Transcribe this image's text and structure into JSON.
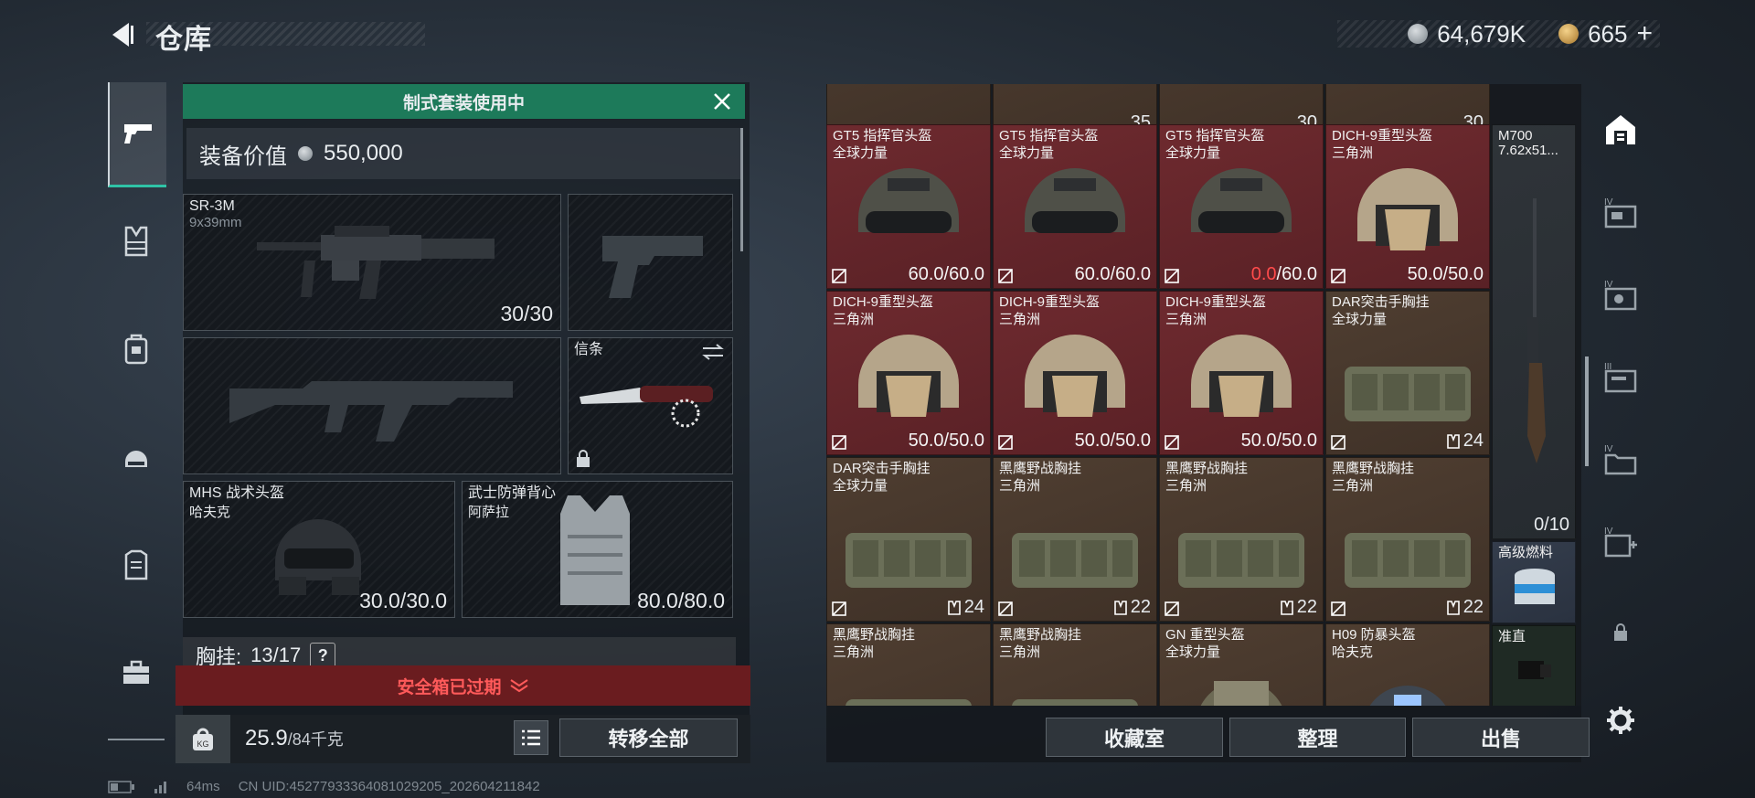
{
  "header": {
    "title": "仓库",
    "currency1": "64,679K",
    "currency2": "665",
    "currency2_suffix": "+"
  },
  "equipment": {
    "banner": "制式套装使用中",
    "value_label": "装备价值",
    "value": "550,000",
    "primary": {
      "name": "SR-3M",
      "ammo": "9x39mm",
      "count": "30/30"
    },
    "knife": {
      "name": "信条"
    },
    "helmet": {
      "name": "MHS 战术头盔",
      "origin": "哈夫克",
      "durability": "30.0/30.0"
    },
    "armor": {
      "name": "武士防弹背心",
      "origin": "阿萨拉",
      "durability": "80.0/80.0"
    },
    "chest_label": "胸挂:",
    "chest_value": "13/17",
    "help": "?",
    "safe_box": "安全箱已过期",
    "weight": "25.9",
    "weight_max": "/84千克",
    "transfer_all": "转移全部"
  },
  "warehouse": {
    "top_counts": [
      "35",
      "30",
      "30"
    ],
    "rows": [
      [
        {
          "name": "GT5 指挥官头盔",
          "sub": "全球力量",
          "val_a": "60.0",
          "val_b": "/60.0",
          "bg": "red",
          "icon": "helmet-gt5"
        },
        {
          "name": "GT5 指挥官头盔",
          "sub": "全球力量",
          "val_a": "60.0",
          "val_b": "/60.0",
          "bg": "red",
          "icon": "helmet-gt5"
        },
        {
          "name": "GT5 指挥官头盔",
          "sub": "全球力量",
          "val_a": "0.0",
          "val_b": "/60.0",
          "bg": "red",
          "icon": "helmet-gt5",
          "val_a_red": true
        },
        {
          "name": "DICH-9重型头盔",
          "sub": "三角洲",
          "val_a": "50.0",
          "val_b": "/50.0",
          "bg": "red",
          "icon": "helmet-dich"
        }
      ],
      [
        {
          "name": "DICH-9重型头盔",
          "sub": "三角洲",
          "val_a": "50.0",
          "val_b": "/50.0",
          "bg": "red",
          "icon": "helmet-dich"
        },
        {
          "name": "DICH-9重型头盔",
          "sub": "三角洲",
          "val_a": "50.0",
          "val_b": "/50.0",
          "bg": "red",
          "icon": "helmet-dich"
        },
        {
          "name": "DICH-9重型头盔",
          "sub": "三角洲",
          "val_a": "50.0",
          "val_b": "/50.0",
          "bg": "red",
          "icon": "helmet-dich"
        },
        {
          "name": "DAR突击手胸挂",
          "sub": "全球力量",
          "count": "24",
          "bg": "brown",
          "icon": "chest-rig"
        }
      ],
      [
        {
          "name": "DAR突击手胸挂",
          "sub": "全球力量",
          "count": "24",
          "bg": "brown",
          "icon": "chest-rig"
        },
        {
          "name": "黑鹰野战胸挂",
          "sub": "三角洲",
          "count": "22",
          "bg": "brown",
          "icon": "chest-rig"
        },
        {
          "name": "黑鹰野战胸挂",
          "sub": "三角洲",
          "count": "22",
          "bg": "brown",
          "icon": "chest-rig"
        },
        {
          "name": "黑鹰野战胸挂",
          "sub": "三角洲",
          "count": "22",
          "bg": "brown",
          "icon": "chest-rig"
        }
      ],
      [
        {
          "name": "黑鹰野战胸挂",
          "sub": "三角洲",
          "bg": "brown",
          "icon": "chest-rig"
        },
        {
          "name": "黑鹰野战胸挂",
          "sub": "三角洲",
          "bg": "brown",
          "icon": "chest-rig"
        },
        {
          "name": "GN 重型头盔",
          "sub": "全球力量",
          "bg": "brown",
          "icon": "helmet-gn"
        },
        {
          "name": "H09 防暴头盔",
          "sub": "哈夫克",
          "bg": "brown",
          "icon": "helmet-h09"
        }
      ]
    ],
    "sniper": {
      "name": "M700",
      "ammo": "7.62x51...",
      "count": "0/10"
    },
    "fuel": {
      "name": "高级燃料"
    },
    "scope": {
      "name": "准直"
    },
    "btn_collection": "收藏室",
    "btn_sort": "整理",
    "btn_sell": "出售"
  },
  "status": {
    "ping": "64ms",
    "uid": "CN UID:4527793336408102920​5_202604211842"
  }
}
